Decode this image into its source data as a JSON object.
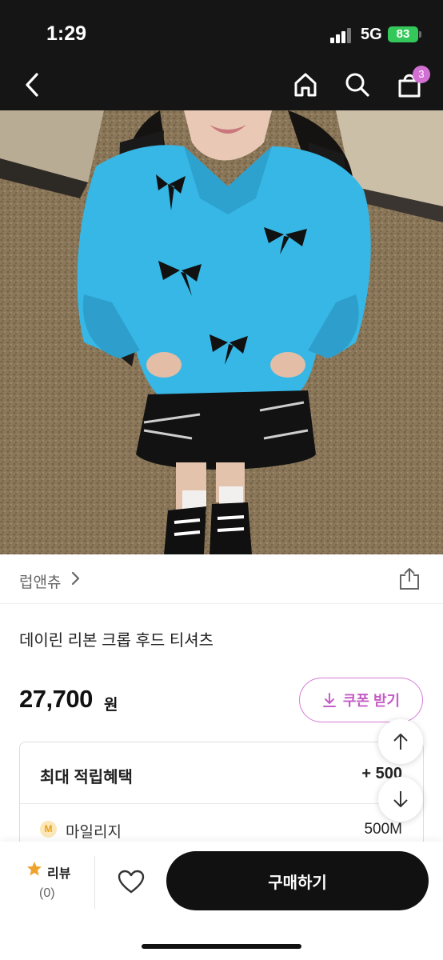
{
  "status_bar": {
    "time": "1:29",
    "network": "5G",
    "battery": "83",
    "battery_color": "#34c759"
  },
  "nav": {
    "back_icon": "chevron-left-icon",
    "home_icon": "home-icon",
    "search_icon": "search-icon",
    "cart_icon": "shopping-bag-icon",
    "cart_count": "3",
    "badge_color": "#d26fd3"
  },
  "hero_image": {
    "subject": "photo-hoodie-model"
  },
  "product": {
    "brand": "럽앤츄",
    "title": "데이린 리본 크롭 후드 티셔츠",
    "price": "27,700",
    "price_unit": "원"
  },
  "coupon": {
    "label": "쿠폰 받기",
    "icon": "download-icon",
    "accent_color": "#c45dc6"
  },
  "benefits": {
    "title": "최대 적립혜택",
    "amount": "+ 500",
    "mileage_icon_letter": "M",
    "mileage_label": "마일리지",
    "mileage_value": "500M"
  },
  "scroll_buttons": {
    "up_icon": "arrow-up-icon",
    "down_icon": "arrow-down-icon"
  },
  "bottom_bar": {
    "review_label": "리뷰",
    "review_count": "(0)",
    "wishlist_icon": "heart-icon",
    "buy_label": "구매하기"
  }
}
